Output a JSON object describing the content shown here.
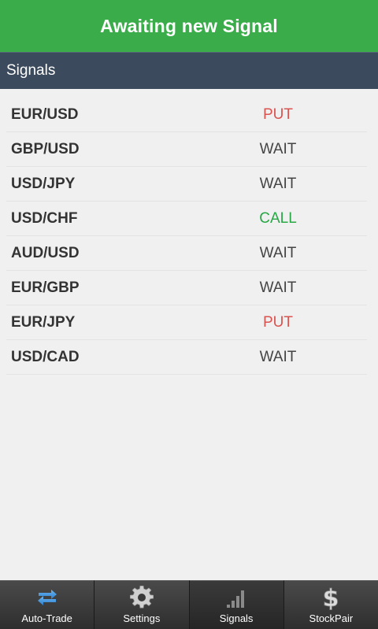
{
  "banner": {
    "title": "Awaiting new Signal",
    "color": "#3aad4a"
  },
  "section": {
    "title": "Signals",
    "color": "#3b4a5c"
  },
  "status_colors": {
    "PUT": "#d9534f",
    "WAIT": "#444444",
    "CALL": "#28a745"
  },
  "signals": [
    {
      "pair": "EUR/USD",
      "status": "PUT"
    },
    {
      "pair": "GBP/USD",
      "status": "WAIT"
    },
    {
      "pair": "USD/JPY",
      "status": "WAIT"
    },
    {
      "pair": "USD/CHF",
      "status": "CALL"
    },
    {
      "pair": "AUD/USD",
      "status": "WAIT"
    },
    {
      "pair": "EUR/GBP",
      "status": "WAIT"
    },
    {
      "pair": "EUR/JPY",
      "status": "PUT"
    },
    {
      "pair": "USD/CAD",
      "status": "WAIT"
    }
  ],
  "tabs": [
    {
      "label": "Auto-Trade",
      "icon": "swap-arrows-icon",
      "active": false
    },
    {
      "label": "Settings",
      "icon": "gear-icon",
      "active": false
    },
    {
      "label": "Signals",
      "icon": "signal-bars-icon",
      "active": true
    },
    {
      "label": "StockPair",
      "icon": "dollar-icon",
      "active": false
    }
  ]
}
